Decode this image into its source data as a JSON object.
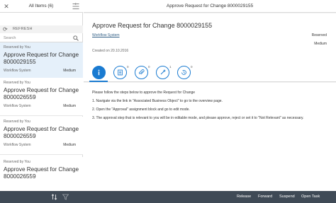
{
  "master": {
    "title": "All Items (6)",
    "refresh_label": "REFRESH",
    "search_placeholder": "Search",
    "items": [
      {
        "reserved": "Reserved by You",
        "title": "Approve Request for Change 8000029155",
        "system": "Workflow System",
        "priority": "Medium"
      },
      {
        "reserved": "Reserved by You",
        "title": "Approve Request for Change 8000026559",
        "system": "Workflow System",
        "priority": "Medium"
      },
      {
        "reserved": "Reserved by You",
        "title": "Approve Request for Change 8000026559",
        "system": "Workflow System",
        "priority": "Medium"
      },
      {
        "reserved": "Reserved by You",
        "title": "Approve Request for Change 8000026559",
        "system": "",
        "priority": ""
      }
    ]
  },
  "detail": {
    "header_title": "Approve Request for Change 8000029155",
    "title": "Approve Request for Change 8000029155",
    "system_link": "Workflow System",
    "created": "Created on 20.10.2016",
    "status": "Reserved",
    "priority": "Medium",
    "tabs": [
      {
        "name": "info",
        "count": ""
      },
      {
        "name": "description",
        "count": "0"
      },
      {
        "name": "attachments",
        "count": "0"
      },
      {
        "name": "related-objects",
        "count": "1"
      },
      {
        "name": "processing-log",
        "count": "0"
      }
    ],
    "content": {
      "intro": "Please follow the steps below to approve the Request for Change",
      "step1": "1. Navigate via the link in \"Associated Business Object\" to go to the overview page.",
      "step2": "2. Open the \"Approval\" assignment block and go to edit mode.",
      "step3": "3. The approval step that is relevant to you will be in editable mode, and please approve, reject or set it to \"Not Relevant\" as necessary."
    }
  },
  "footer": {
    "release": "Release",
    "forward": "Forward",
    "suspend": "Suspend",
    "open_task": "Open Task"
  },
  "colors": {
    "accent": "#1a7bd1",
    "footer_bg": "#3f4a56",
    "selected_bg": "#e5f0fa",
    "link": "#346187"
  }
}
